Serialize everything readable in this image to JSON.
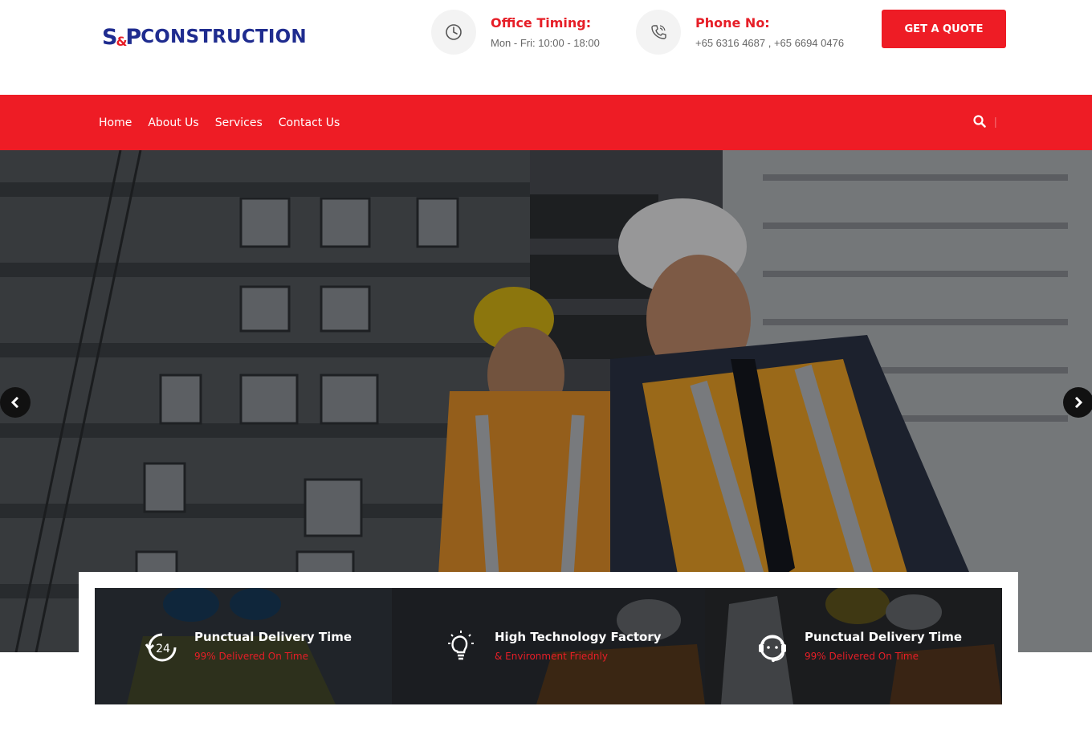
{
  "brand": {
    "mark": "S",
    "mark_amp": "&",
    "mark_p": "P",
    "name": "CONSTRUCTION"
  },
  "header": {
    "timing": {
      "title": "Office Timing:",
      "value": "Mon - Fri: 10:00 - 18:00",
      "icon": "clock-icon"
    },
    "phone": {
      "title": "Phone No:",
      "value": "+65 6316 4687 , +65 6694 0476",
      "icon": "phone-icon"
    },
    "cta": "GET A QUOTE"
  },
  "nav": {
    "items": [
      {
        "label": "Home"
      },
      {
        "label": "About Us"
      },
      {
        "label": "Services"
      },
      {
        "label": "Contact Us"
      }
    ],
    "separator": "|"
  },
  "hero": {
    "prev_icon": "chevron-left-icon",
    "next_icon": "chevron-right-icon"
  },
  "features": [
    {
      "title": "Punctual Delivery Time",
      "subtitle": "99% Delivered On Time",
      "icon": "24-hours-icon",
      "badge": "24"
    },
    {
      "title": "High Technology Factory",
      "subtitle": "& Environment Friednly",
      "icon": "lightbulb-icon"
    },
    {
      "title": "Punctual Delivery Time",
      "subtitle": "99% Delivered On Time",
      "icon": "support-agent-icon"
    }
  ],
  "colors": {
    "accent": "#ee1c25",
    "brand_blue": "#1f2c8f",
    "dark": "#111111"
  }
}
